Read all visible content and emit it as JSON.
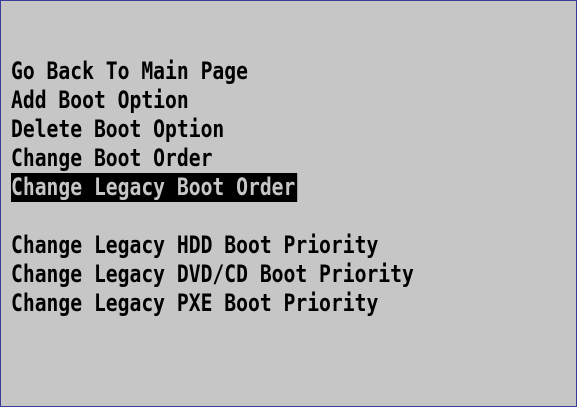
{
  "menu": {
    "items": [
      {
        "label": "Go Back To Main Page",
        "selected": false
      },
      {
        "label": "Add Boot Option",
        "selected": false
      },
      {
        "label": "Delete Boot Option",
        "selected": false
      },
      {
        "label": "Change Boot Order",
        "selected": false
      },
      {
        "label": "Change Legacy Boot Order",
        "selected": true
      }
    ],
    "legacy_items": [
      {
        "label": "Change Legacy HDD Boot Priority",
        "selected": false
      },
      {
        "label": "Change Legacy DVD/CD Boot Priority",
        "selected": false
      },
      {
        "label": "Change Legacy PXE Boot Priority",
        "selected": false
      }
    ]
  },
  "colors": {
    "background": "#c6c6c6",
    "text": "#000000",
    "highlight_bg": "#000000",
    "highlight_text": "#c6c6c6",
    "border": "#3b3b9a"
  }
}
